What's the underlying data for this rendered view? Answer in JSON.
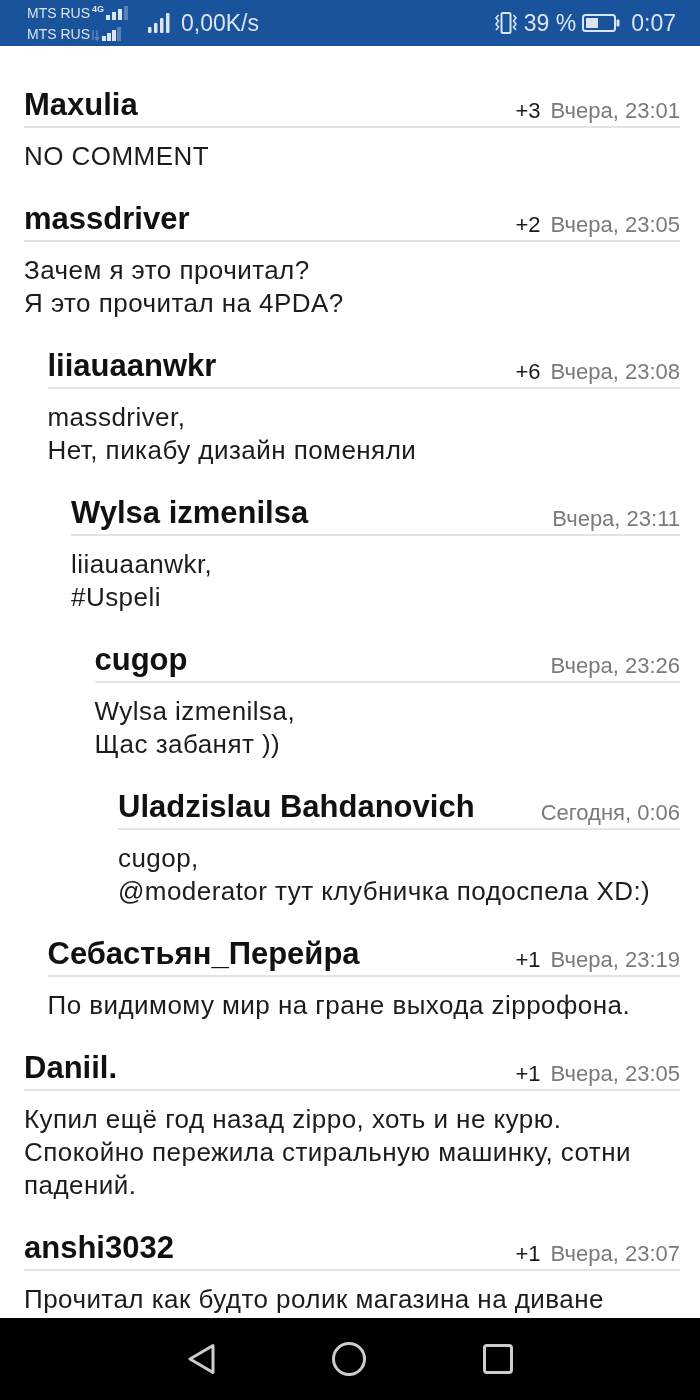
{
  "status_bar": {
    "carriers": [
      {
        "name": "MTS RUS",
        "network": "4G"
      },
      {
        "name": "MTS RUS"
      }
    ],
    "data_speed": "0,00K/s",
    "battery_percent": "39 %",
    "time": "0:07"
  },
  "comments": [
    {
      "author": "Maxulia",
      "rating": "+3",
      "time": "Вчера, 23:01",
      "text": "NO COMMENT"
    },
    {
      "author": "massdriver",
      "rating": "+2",
      "time": "Вчера, 23:05",
      "text": "Зачем я это прочитал?\nЯ это прочитал на 4PDA?",
      "children": [
        {
          "author": "liiauaanwkr",
          "rating": "+6",
          "time": "Вчера, 23:08",
          "text": "massdriver,\nНет, пикабу дизайн поменяли",
          "children": [
            {
              "author": "Wylsa izmenilsa",
              "time": "Вчера, 23:11",
              "text": "liiauaanwkr,\n#Uspeli",
              "children": [
                {
                  "author": "cugop",
                  "time": "Вчера, 23:26",
                  "text": "Wylsa izmenilsa,\nЩас забанят ))",
                  "children": [
                    {
                      "author": "Uladzislau Bahdanovich",
                      "time": "Сегодня, 0:06",
                      "text": "cugop,\n@moderator тут клубничка подоспела XD:)"
                    }
                  ]
                }
              ]
            }
          ]
        },
        {
          "author": "Себастьян_Перейра",
          "rating": "+1",
          "time": "Вчера, 23:19",
          "text": "По видимому мир на гране выхода zippофона."
        }
      ]
    },
    {
      "author": "Daniil.",
      "rating": "+1",
      "time": "Вчера, 23:05",
      "text": "Купил ещё год назад zippo, хоть и не курю. Спокойно пережила стиральную машинку, сотни падений."
    },
    {
      "author": "anshi3032",
      "rating": "+1",
      "time": "Вчера, 23:07",
      "text": "Прочитал как будто ролик магазина на диване"
    }
  ]
}
